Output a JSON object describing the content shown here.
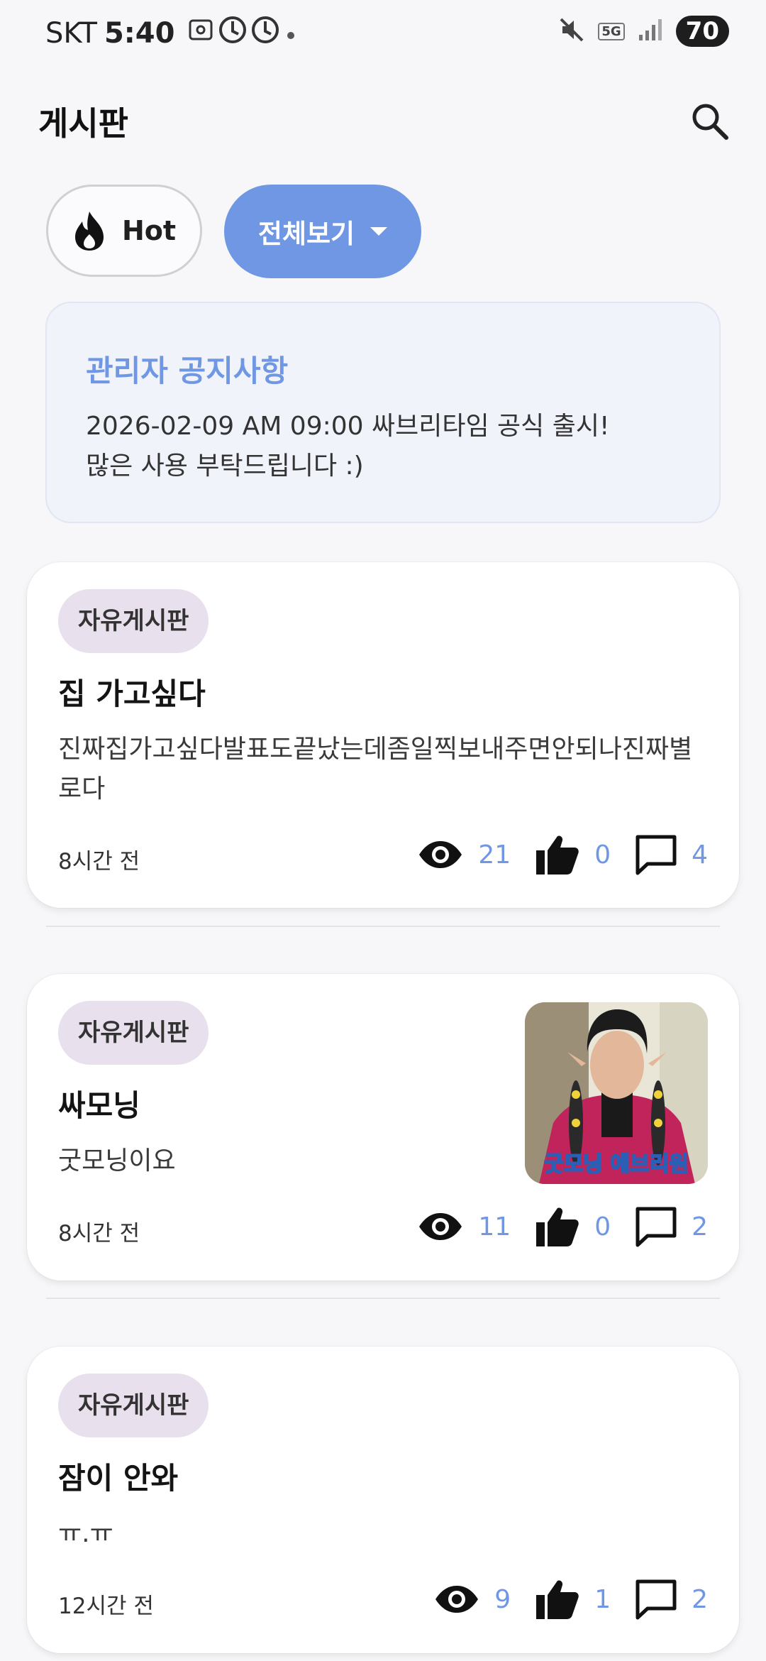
{
  "status_bar": {
    "carrier": "SKT",
    "time": "5:40",
    "network": "5G",
    "battery": "70"
  },
  "header": {
    "title": "게시판"
  },
  "filters": {
    "hot_label": "Hot",
    "all_label": "전체보기"
  },
  "notice": {
    "title": "관리자 공지사항",
    "body": "2026-02-09 AM 09:00 싸브리타임 공식 출시!\n많은 사용 부탁드립니다 :)"
  },
  "posts": [
    {
      "category": "자유게시판",
      "title": "집 가고싶다",
      "body": "진짜집가고싶다발표도끝났는데좀일찍보내주면안되나진짜별로다",
      "time": "8시간 전",
      "views": "21",
      "likes": "0",
      "comments": "4"
    },
    {
      "category": "자유게시판",
      "title": "싸모닝",
      "body": "굿모닝이요",
      "time": "8시간 전",
      "views": "11",
      "likes": "0",
      "comments": "2",
      "thumbnail_caption": "굿모닝 에브리원"
    },
    {
      "category": "자유게시판",
      "title": "잠이 안와",
      "body": "ㅠ.ㅠ",
      "time": "12시간 전",
      "views": "9",
      "likes": "1",
      "comments": "2"
    }
  ],
  "colors": {
    "accent": "#6f97e3",
    "tag_bg": "#e8e0ec",
    "notice_bg": "#f1f3fb",
    "background": "#f7f7f9"
  },
  "icons": {
    "search": "search-icon",
    "hot": "flame-icon",
    "views": "eye-icon",
    "likes": "thumbs-up-icon",
    "comments": "comment-icon"
  }
}
